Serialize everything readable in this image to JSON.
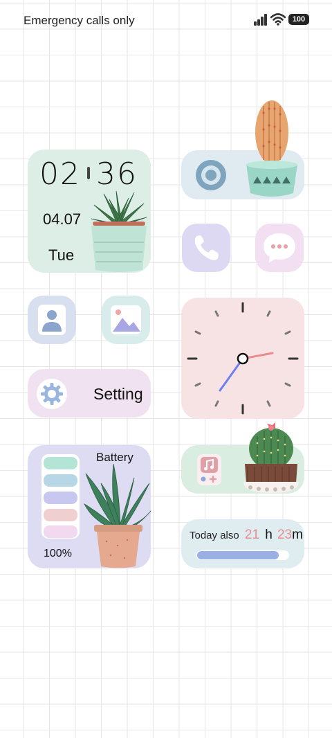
{
  "status_bar": {
    "carrier_text": "Emergency calls only",
    "battery_level": "100",
    "signal_bars": 4,
    "wifi": "wifi-icon"
  },
  "clock_widget": {
    "hour": "02",
    "minute": "36",
    "date": "04.07",
    "day": "Tue",
    "bg_color": "#dceee6"
  },
  "camera_widget": {
    "icon": "camera-lens-icon"
  },
  "apps": {
    "phone": {
      "icon": "phone-icon"
    },
    "messages": {
      "icon": "message-bubble-icon"
    },
    "contacts": {
      "icon": "contact-icon"
    },
    "gallery": {
      "icon": "gallery-icon"
    }
  },
  "analog_clock": {
    "hour_hand": "hour hand",
    "time_shown": "02:36"
  },
  "settings_widget": {
    "label": "Setting",
    "icon": "gear-icon"
  },
  "music_widget": {
    "icon": "music-note-icon"
  },
  "battery_widget": {
    "title": "Battery",
    "percent_text": "100%",
    "bar_colors": [
      "#b3e4d6",
      "#b7d6e6",
      "#c8c7ef",
      "#efcfcf",
      "#f3d9f0"
    ]
  },
  "screen_time": {
    "label": "Today also",
    "hours": "21",
    "hours_unit": "h",
    "minutes": "23",
    "minutes_unit": "m",
    "progress": 0.88
  },
  "colors": {
    "accent_pink": "#e48e8e",
    "progress_blue": "#9ab0e4"
  }
}
